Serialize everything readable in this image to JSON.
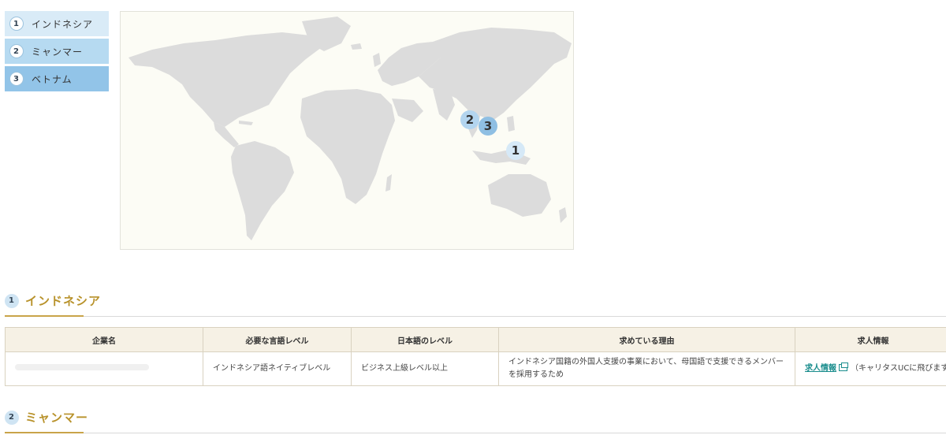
{
  "tabs": [
    {
      "num": "1",
      "label": "インドネシア"
    },
    {
      "num": "2",
      "label": "ミャンマー"
    },
    {
      "num": "3",
      "label": "ベトナム"
    }
  ],
  "map": {
    "land_color": "#dcdcdc",
    "pins": [
      {
        "num": "1",
        "color": "#d6e9f7"
      },
      {
        "num": "2",
        "color": "#b3d5ef"
      },
      {
        "num": "3",
        "color": "#8fbfe3"
      }
    ]
  },
  "sections": [
    {
      "num": "1",
      "title": "インドネシア"
    },
    {
      "num": "2",
      "title": "ミャンマー"
    }
  ],
  "table": {
    "headers": [
      "企業名",
      "必要な言語レベル",
      "日本語のレベル",
      "求めている理由",
      "求人情報"
    ],
    "row": {
      "company": "",
      "language_level": "インドネシア語ネイティブレベル",
      "japanese_level": "ビジネス上級レベル以上",
      "reason": "インドネシア国籍の外国人支援の事業において、母国語で支援できるメンバーを採用するため",
      "job_link": "求人情報",
      "job_note": "（キャリタスUCに飛びます）"
    }
  },
  "colors": {
    "accent": "#b8922b",
    "tab1": "#d9ebf7",
    "tab2": "#b6daf1",
    "tab3": "#92c4e8",
    "link": "#1a8d8d"
  }
}
